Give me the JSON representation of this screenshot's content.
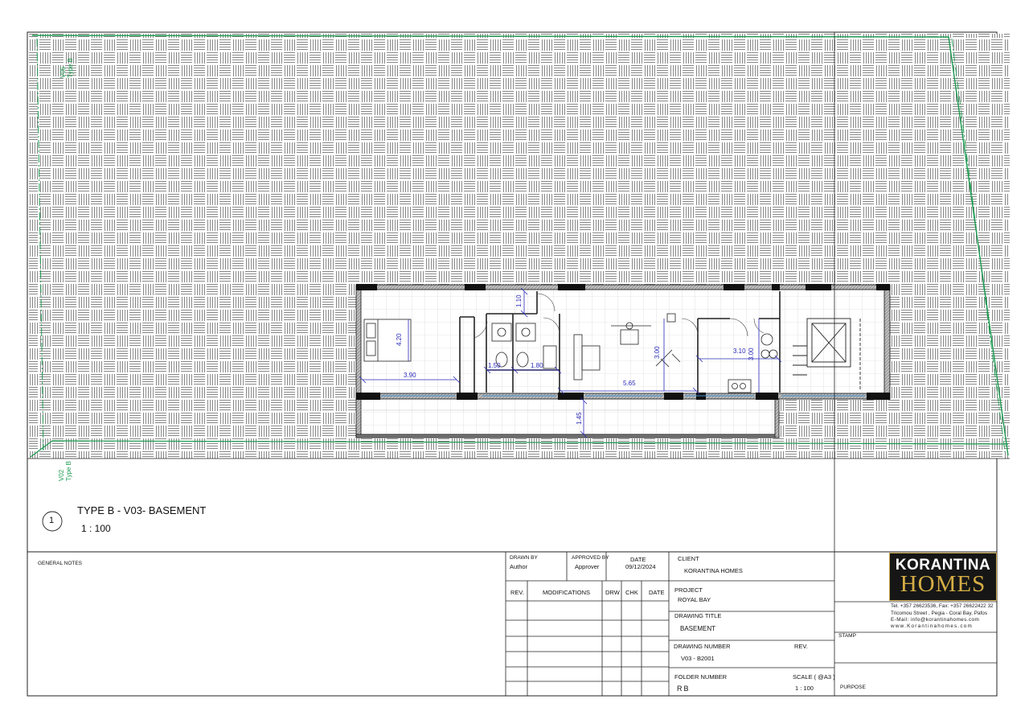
{
  "view": {
    "title": "TYPE B - V03- BASEMENT",
    "scale": "1 : 100",
    "number": "1"
  },
  "neighbors": {
    "v05_code": "V05",
    "v05_type": "Type B",
    "v02_code": "V02",
    "v02_type": "Type B"
  },
  "dimensions": {
    "d_110": "1.10",
    "d_420": "4.20",
    "d_390": "3.90",
    "d_150": "1.50",
    "d_180": "1.80",
    "d_565": "5.65",
    "d_300a": "3.00",
    "d_310": "3.10",
    "d_300b": "3.00",
    "d_145": "1.45"
  },
  "title_block": {
    "general_notes_label": "GENERAL NOTES",
    "drawn_by_label": "DRAWN BY",
    "drawn_by": "Author",
    "approved_by_label": "APPROVED BY",
    "approved_by": "Approver",
    "date_label": "DATE",
    "date": "09/12/2024",
    "rev_label": "REV.",
    "modifications_label": "MODIFICATIONS",
    "drw_label": "DRW",
    "chk_label": "CHK",
    "date_col_label": "DATE",
    "client_label": "CLIENT",
    "client": "KORANTINA HOMES",
    "project_label": "PROJECT",
    "project": "ROYAL BAY",
    "drawing_title_label": "DRAWING TITLE",
    "drawing_title": "BASEMENT",
    "drawing_number_label": "DRAWING NUMBER",
    "drawing_number": "V03 - B2001",
    "rev_label2": "REV.",
    "folder_number_label": "FOLDER NUMBER",
    "folder_number": "RB",
    "scale_label": "SCALE ( @A3 )",
    "scale": "1 : 100",
    "stamp_label": "STAMP",
    "purpose_label": "PURPOSE"
  },
  "company": {
    "logo_line1": "KORANTINA",
    "logo_line2": "HOMES",
    "tel": "Tel. +357 26623536, Fax: +357 26622422 32",
    "address": "Tricomou Street , Pegia - Coral Bay, Pafos",
    "email": "E-Mail: info@korantinahomes.com",
    "web": "www.Korantinahomes.com"
  },
  "colors": {
    "boundary": "#1a9a4f",
    "dimension": "#2a2ab8",
    "wall": "#111111",
    "glazing": "#3a8fd0"
  }
}
